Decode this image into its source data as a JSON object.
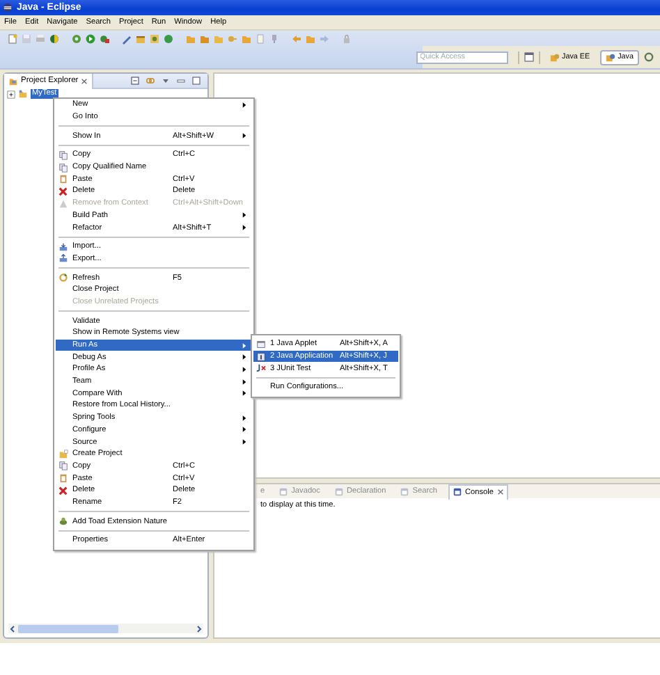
{
  "window": {
    "title": "Java - Eclipse"
  },
  "menu_bar": [
    "File",
    "Edit",
    "Navigate",
    "Search",
    "Project",
    "Run",
    "Window",
    "Help"
  ],
  "quick_access": {
    "placeholder": "Quick Access"
  },
  "perspectives": [
    {
      "label": "Java EE",
      "selected": false
    },
    {
      "label": "Java",
      "selected": true
    }
  ],
  "project_explorer": {
    "title": "Project Explorer",
    "tree": [
      {
        "label": "MyTest",
        "selected": true,
        "expanded": false
      }
    ]
  },
  "context_menu": [
    {
      "kind": "item",
      "label": "New",
      "submenu": true,
      "selected": false
    },
    {
      "kind": "item",
      "label": "Go Into",
      "selected": false
    },
    {
      "kind": "separator"
    },
    {
      "kind": "item",
      "label": "Show In",
      "shortcut": "Alt+Shift+W",
      "submenu": true,
      "selected": false
    },
    {
      "kind": "separator"
    },
    {
      "kind": "copy",
      "label": "Copy",
      "shortcut": "Ctrl+C",
      "selected": false
    },
    {
      "kind": "copy",
      "label": "Copy Qualified Name",
      "selected": false
    },
    {
      "kind": "paste",
      "label": "Paste",
      "shortcut": "Ctrl+V",
      "selected": false
    },
    {
      "kind": "delete",
      "label": "Delete",
      "shortcut": "Delete",
      "selected": false
    },
    {
      "kind": "remove",
      "label": "Remove from Context",
      "shortcut": "Ctrl+Alt+Shift+Down",
      "disabled": true,
      "selected": false
    },
    {
      "kind": "item",
      "label": "Build Path",
      "submenu": true,
      "selected": false
    },
    {
      "kind": "item",
      "label": "Refactor",
      "shortcut": "Alt+Shift+T",
      "submenu": true,
      "selected": false
    },
    {
      "kind": "separator"
    },
    {
      "kind": "import",
      "label": "Import...",
      "selected": false
    },
    {
      "kind": "export",
      "label": "Export...",
      "selected": false
    },
    {
      "kind": "separator"
    },
    {
      "kind": "refresh",
      "label": "Refresh",
      "shortcut": "F5",
      "selected": false
    },
    {
      "kind": "item",
      "label": "Close Project",
      "selected": false
    },
    {
      "kind": "item",
      "label": "Close Unrelated Projects",
      "disabled": true,
      "selected": false
    },
    {
      "kind": "separator"
    },
    {
      "kind": "item",
      "label": "Validate",
      "selected": false
    },
    {
      "kind": "item",
      "label": "Show in Remote Systems view",
      "selected": false
    },
    {
      "kind": "item",
      "label": "Run As",
      "submenu": true,
      "selected": true
    },
    {
      "kind": "item",
      "label": "Debug As",
      "submenu": true,
      "selected": false
    },
    {
      "kind": "item",
      "label": "Profile As",
      "submenu": true,
      "selected": false
    },
    {
      "kind": "item",
      "label": "Team",
      "submenu": true,
      "selected": false
    },
    {
      "kind": "item",
      "label": "Compare With",
      "submenu": true,
      "selected": false
    },
    {
      "kind": "item",
      "label": "Restore from Local History...",
      "selected": false
    },
    {
      "kind": "item",
      "label": "Spring Tools",
      "submenu": true,
      "selected": false
    },
    {
      "kind": "item",
      "label": "Configure",
      "submenu": true,
      "selected": false
    },
    {
      "kind": "item",
      "label": "Source",
      "submenu": true,
      "selected": false
    },
    {
      "kind": "project",
      "label": "Create Project",
      "selected": false
    },
    {
      "kind": "copy",
      "label": "Copy",
      "shortcut": "Ctrl+C",
      "selected": false
    },
    {
      "kind": "paste",
      "label": "Paste",
      "shortcut": "Ctrl+V",
      "selected": false
    },
    {
      "kind": "delete",
      "label": "Delete",
      "shortcut": "Delete",
      "selected": false
    },
    {
      "kind": "item",
      "label": "Rename",
      "shortcut": "F2",
      "selected": false
    },
    {
      "kind": "separator"
    },
    {
      "kind": "toad",
      "label": "Add Toad Extension Nature",
      "selected": false
    },
    {
      "kind": "separator"
    },
    {
      "kind": "item",
      "label": "Properties",
      "shortcut": "Alt+Enter",
      "selected": false
    }
  ],
  "run_as_submenu": [
    {
      "kind": "applet",
      "label": "1 Java Applet",
      "shortcut": "Alt+Shift+X, A",
      "selected": false
    },
    {
      "kind": "application",
      "label": "2 Java Application",
      "shortcut": "Alt+Shift+X, J",
      "selected": true
    },
    {
      "kind": "junit",
      "label": "3 JUnit Test",
      "shortcut": "Alt+Shift+X, T",
      "selected": false
    },
    {
      "kind": "separator"
    },
    {
      "kind": "item",
      "label": "Run Configurations...",
      "selected": false
    }
  ],
  "bottom_panel": {
    "tabs": [
      {
        "label": "e",
        "selected": false
      },
      {
        "label": "Javadoc",
        "selected": false
      },
      {
        "label": "Declaration",
        "selected": false
      },
      {
        "label": "Search",
        "selected": false
      },
      {
        "label": "Console",
        "selected": true
      }
    ],
    "message": "to display at this time."
  }
}
